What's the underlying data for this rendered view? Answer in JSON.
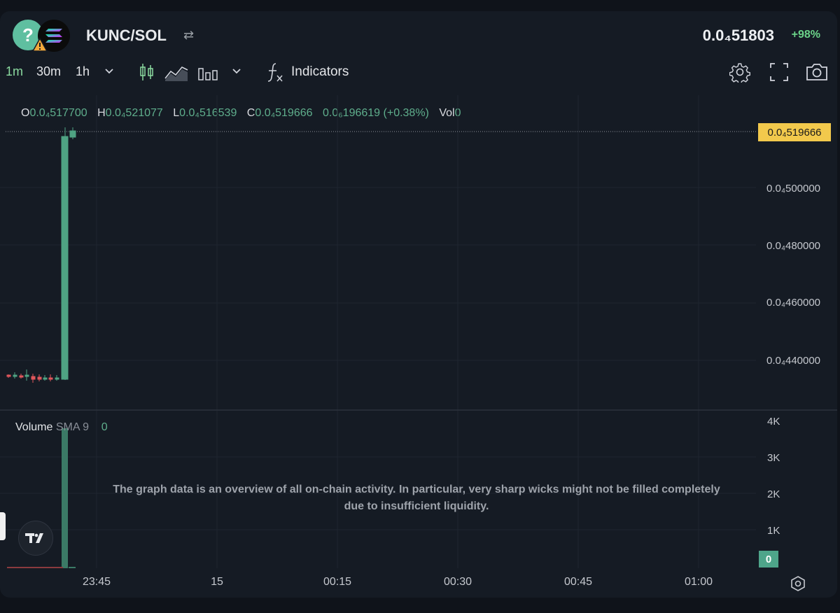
{
  "header": {
    "pair": "KUNC/SOL",
    "swap_icon": "swap-arrows-icon",
    "token_placeholder": "?",
    "price": "0.0₄518 03",
    "price_display": "0.0₄51803",
    "change": "+98%"
  },
  "toolbar": {
    "timeframes": [
      "1m",
      "30m",
      "1h"
    ],
    "active_timeframe": "1m",
    "indicators_label": "Indicators",
    "icons": [
      "candles-icon",
      "area-chart-icon",
      "bars-icon",
      "fx-icon",
      "settings-gear-icon",
      "fullscreen-icon",
      "camera-icon"
    ]
  },
  "ohlc": {
    "o_key": "O",
    "o_val": "0.0₄517700",
    "h_key": "H",
    "h_val": "0.0₄521077",
    "l_key": "L",
    "l_val": "0.0₄516539",
    "c_key": "C",
    "c_val": "0.0₄519666",
    "change_val": "0.0₆196619 (+0.38%)",
    "vol_key": "Vol",
    "vol_val": "0"
  },
  "price_axis": {
    "last_price": "0.0₄519666",
    "labels": [
      "0.0₄500000",
      "0.0₄480000",
      "0.0₄460000",
      "0.0₄440000"
    ]
  },
  "volume": {
    "label": "Volume",
    "sma_label": "SMA 9",
    "value": "0",
    "axis_labels": [
      "4K",
      "3K",
      "2K",
      "1K"
    ],
    "current": "0"
  },
  "note": "The graph data is an overview of all on-chain activity. In particular, very sharp wicks might not be filled completely due to insufficient liquidity.",
  "time_axis": [
    "23:45",
    "15",
    "00:15",
    "00:30",
    "00:45",
    "01:00"
  ],
  "colors": {
    "up": "#4fa383",
    "down": "#e0565b",
    "accent": "#8bdba0",
    "last_price_bg": "#f2c94c"
  }
}
